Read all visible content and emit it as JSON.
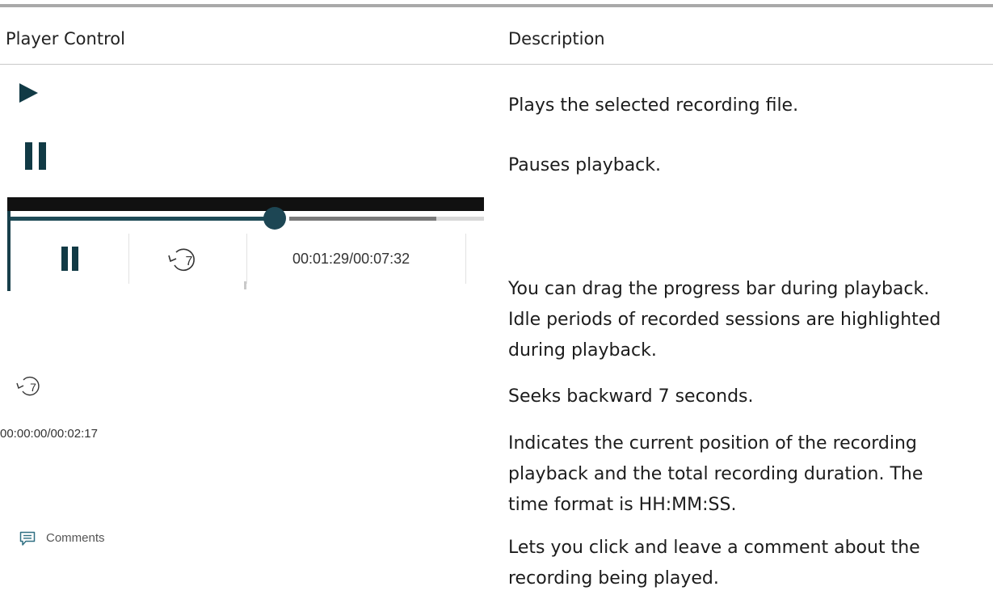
{
  "table": {
    "header": {
      "control": "Player Control",
      "description": "Description"
    },
    "rows": [
      {
        "description": "Plays the selected recording file."
      },
      {
        "description": "Pauses playback."
      },
      {
        "player_time": "00:01:29/00:07:32",
        "seek_number": "7",
        "progress_fraction": 0.56,
        "description_lines": [
          "You can drag the progress bar during playback.",
          "Idle periods of recorded sessions are highlighted",
          "during playback."
        ]
      },
      {
        "seek_number": "7",
        "description": "Seeks backward 7 seconds."
      },
      {
        "time": "00:00:00/00:02:17",
        "description_lines": [
          "Indicates the current position of the recording",
          "playback and the total recording duration.  The",
          "time format is HH:MM:SS."
        ]
      },
      {
        "label": "Comments",
        "description_lines": [
          "Lets you click and leave a comment about the",
          "recording being played."
        ]
      }
    ]
  },
  "icons": {
    "play": "play-icon",
    "pause": "pause-icon",
    "rewind": "rewind-7-icon",
    "comment": "comment-icon"
  },
  "colors": {
    "icon": "#113a45",
    "progress_played": "#1f4b57",
    "progress_buffered": "#7a7a7a",
    "progress_remaining": "#d8d8d8",
    "player_bar": "#111111"
  }
}
